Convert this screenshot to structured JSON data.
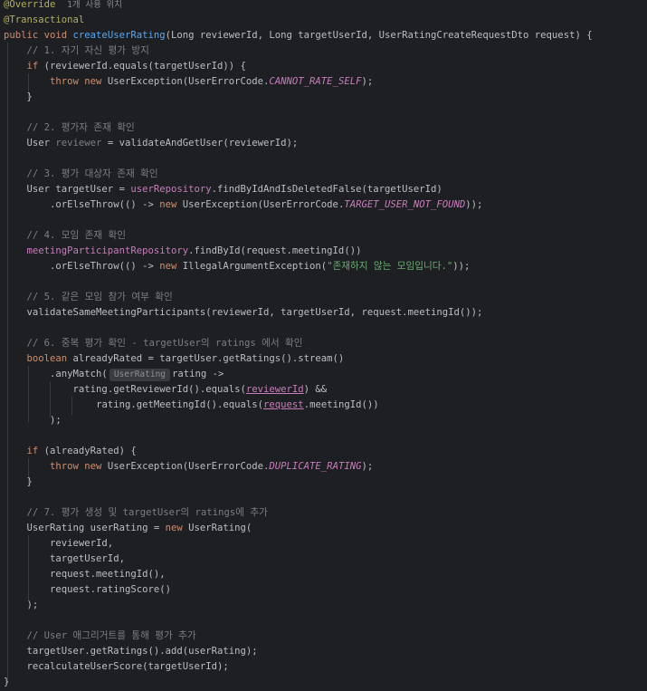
{
  "editor": {
    "annotation_override": "@Override",
    "usage_hint": "1개 사용 위치",
    "annotation_transactional": "@Transactional",
    "inlay_hint": "UserRating",
    "lines": {
      "l3_kw": "public void ",
      "l3_fn": "createUserRating",
      "l3_rest": "(Long reviewerId, Long targetUserId, UserRatingCreateRequestDto request) {",
      "c1": "// 1. 자기 자신 평가 방지",
      "l5_kw": "if ",
      "l5_rest": "(reviewerId.equals(targetUserId)) {",
      "l6_kw": "throw new ",
      "l6_rest": "UserException(UserErrorCode.",
      "l6_const": "CANNOT_RATE_SELF",
      "l6_end": ");",
      "brace_close": "}",
      "c2": "// 2. 평가자 존재 확인",
      "l10_type": "User ",
      "l10_var": "reviewer",
      "l10_rest": " = validateAndGetUser(reviewerId);",
      "c3": "// 3. 평가 대상자 존재 확인",
      "l13_a": "User targetUser = ",
      "l13_fld": "userRepository",
      "l13_b": ".findByIdAndIsDeletedFalse(targetUserId)",
      "l14_a": ".orElseThrow(() -> ",
      "l14_kw": "new ",
      "l14_b": "UserException(UserErrorCode.",
      "l14_const": "TARGET_USER_NOT_FOUND",
      "l14_end": "));",
      "c4": "// 4. 모임 존재 확인",
      "l17_fld": "meetingParticipantRepository",
      "l17_b": ".findById(request.meetingId())",
      "l18_a": ".orElseThrow(() -> ",
      "l18_kw": "new ",
      "l18_b": "IllegalArgumentException(",
      "l18_str": "\"존재하지 않는 모임입니다.\"",
      "l18_end": "));",
      "c5": "// 5. 같은 모임 참가 여부 확인",
      "l21": "validateSameMeetingParticipants(reviewerId, targetUserId, request.meetingId());",
      "c6": "// 6. 중복 평가 확인 - targetUser의 ratings 에서 확인",
      "l24_kw": "boolean ",
      "l24_rest": "alreadyRated = targetUser.getRatings().stream()",
      "l25_a": ".anyMatch(",
      "l25_b": "rating ->",
      "l26_a": "rating.getReviewerId().equals(",
      "l26_ul": "reviewerId",
      "l26_b": ") &&",
      "l27_a": "rating.getMeetingId().equals(",
      "l27_ul": "request",
      "l27_b": ".meetingId())",
      "l28": ");",
      "l30_kw": "if ",
      "l30_rest": "(alreadyRated) {",
      "l31_kw": "throw new ",
      "l31_rest": "UserException(UserErrorCode.",
      "l31_const": "DUPLICATE_RATING",
      "l31_end": ");",
      "c7": "// 7. 평가 생성 및 targetUser의 ratings에 추가",
      "l35_a": "UserRating userRating = ",
      "l35_kw": "new ",
      "l35_b": "UserRating(",
      "l36": "reviewerId,",
      "l37": "targetUserId,",
      "l38": "request.meetingId(),",
      "l39": "request.ratingScore()",
      "l40": ");",
      "c8": "// User 애그리거트를 통해 평가 추가",
      "l43": "targetUser.getRatings().add(userRating);",
      "l44": "recalculateUserScore(targetUserId);",
      "l45": "}"
    }
  }
}
